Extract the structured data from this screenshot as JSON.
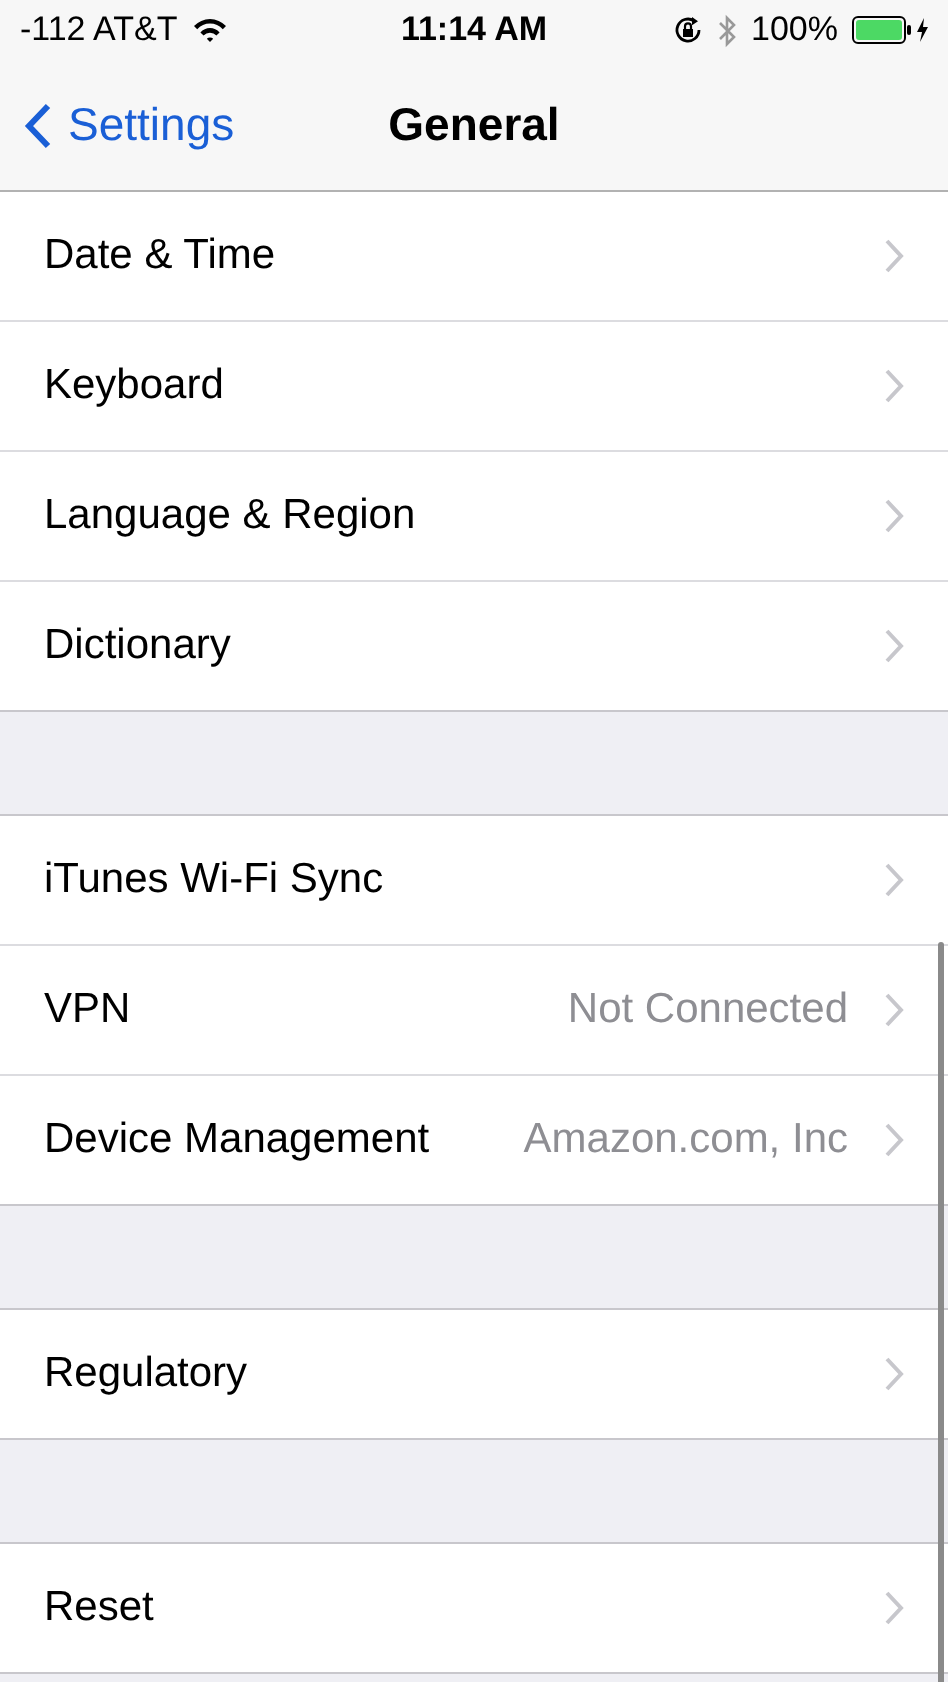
{
  "status_bar": {
    "carrier": "-112 AT&T",
    "time": "11:14 AM",
    "battery": "100%"
  },
  "nav_bar": {
    "back": "Settings",
    "title": "General"
  },
  "sections": [
    {
      "rows": [
        {
          "label": "Date & Time"
        },
        {
          "label": "Keyboard"
        },
        {
          "label": "Language & Region"
        },
        {
          "label": "Dictionary"
        }
      ]
    },
    {
      "rows": [
        {
          "label": "iTunes Wi-Fi Sync"
        },
        {
          "label": "VPN",
          "value": "Not Connected"
        },
        {
          "label": "Device Management",
          "value": "Amazon.com, Inc"
        }
      ]
    },
    {
      "rows": [
        {
          "label": "Regulatory"
        }
      ]
    },
    {
      "rows": [
        {
          "label": "Reset"
        }
      ]
    }
  ]
}
